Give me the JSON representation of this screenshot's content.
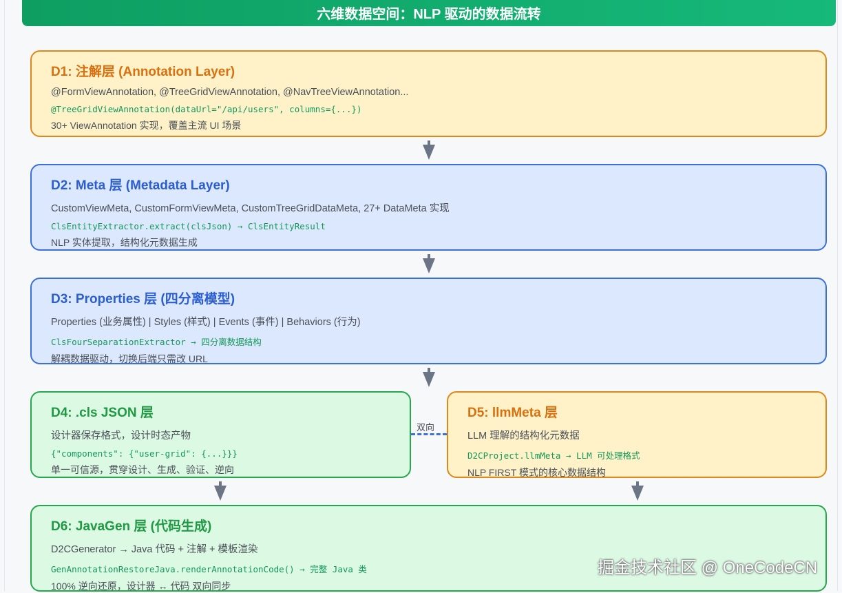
{
  "header": {
    "title": "六维数据空间：NLP 驱动的数据流转"
  },
  "layers": {
    "d1": {
      "title": "D1: 注解层 (Annotation Layer)",
      "desc": "@FormViewAnnotation, @TreeGridViewAnnotation, @NavTreeViewAnnotation...",
      "code": "@TreeGridViewAnnotation(dataUrl=\"/api/users\", columns={...})",
      "note": "30+ ViewAnnotation 实现，覆盖主流 UI 场景"
    },
    "d2": {
      "title": "D2: Meta 层 (Metadata Layer)",
      "desc": "CustomViewMeta, CustomFormViewMeta, CustomTreeGridDataMeta, 27+ DataMeta 实现",
      "code": "ClsEntityExtractor.extract(clsJson) → ClsEntityResult",
      "note": "NLP 实体提取，结构化元数据生成"
    },
    "d3": {
      "title": "D3: Properties 层 (四分离模型)",
      "desc": "Properties (业务属性) | Styles (样式) | Events (事件) | Behaviors (行为)",
      "code": "ClsFourSeparationExtractor → 四分离数据结构",
      "note": "解耦数据驱动，切换后端只需改 URL"
    },
    "d4": {
      "title": "D4: .cls JSON 层",
      "desc": "设计器保存格式，设计时态产物",
      "code": "{\"components\": {\"user-grid\": {...}}}",
      "note": "单一可信源，贯穿设计、生成、验证、逆向"
    },
    "d5": {
      "title": "D5: llmMeta 层",
      "desc": "LLM 理解的结构化元数据",
      "code": "D2CProject.llmMeta → LLM 可处理格式",
      "note": "NLP FIRST 模式的核心数据结构"
    },
    "d6": {
      "title": "D6: JavaGen 层 (代码生成)",
      "desc": "D2CGenerator → Java 代码 + 注解 + 模板渲染",
      "code": "GenAnnotationRestoreJava.renderAnnotationCode() → 完整 Java 类",
      "note": "100% 逆向还原，设计器 ↔ 代码 双向同步"
    }
  },
  "connector": {
    "bidirectional_label": "双向"
  },
  "watermark": "掘金技术社区 @ OneCodeCN",
  "colors": {
    "header": "#10a86b",
    "yellow_border": "#e0871a",
    "blue_border": "#3a6fdc",
    "green_border": "#25a74c",
    "arrow": "#6b7586"
  }
}
